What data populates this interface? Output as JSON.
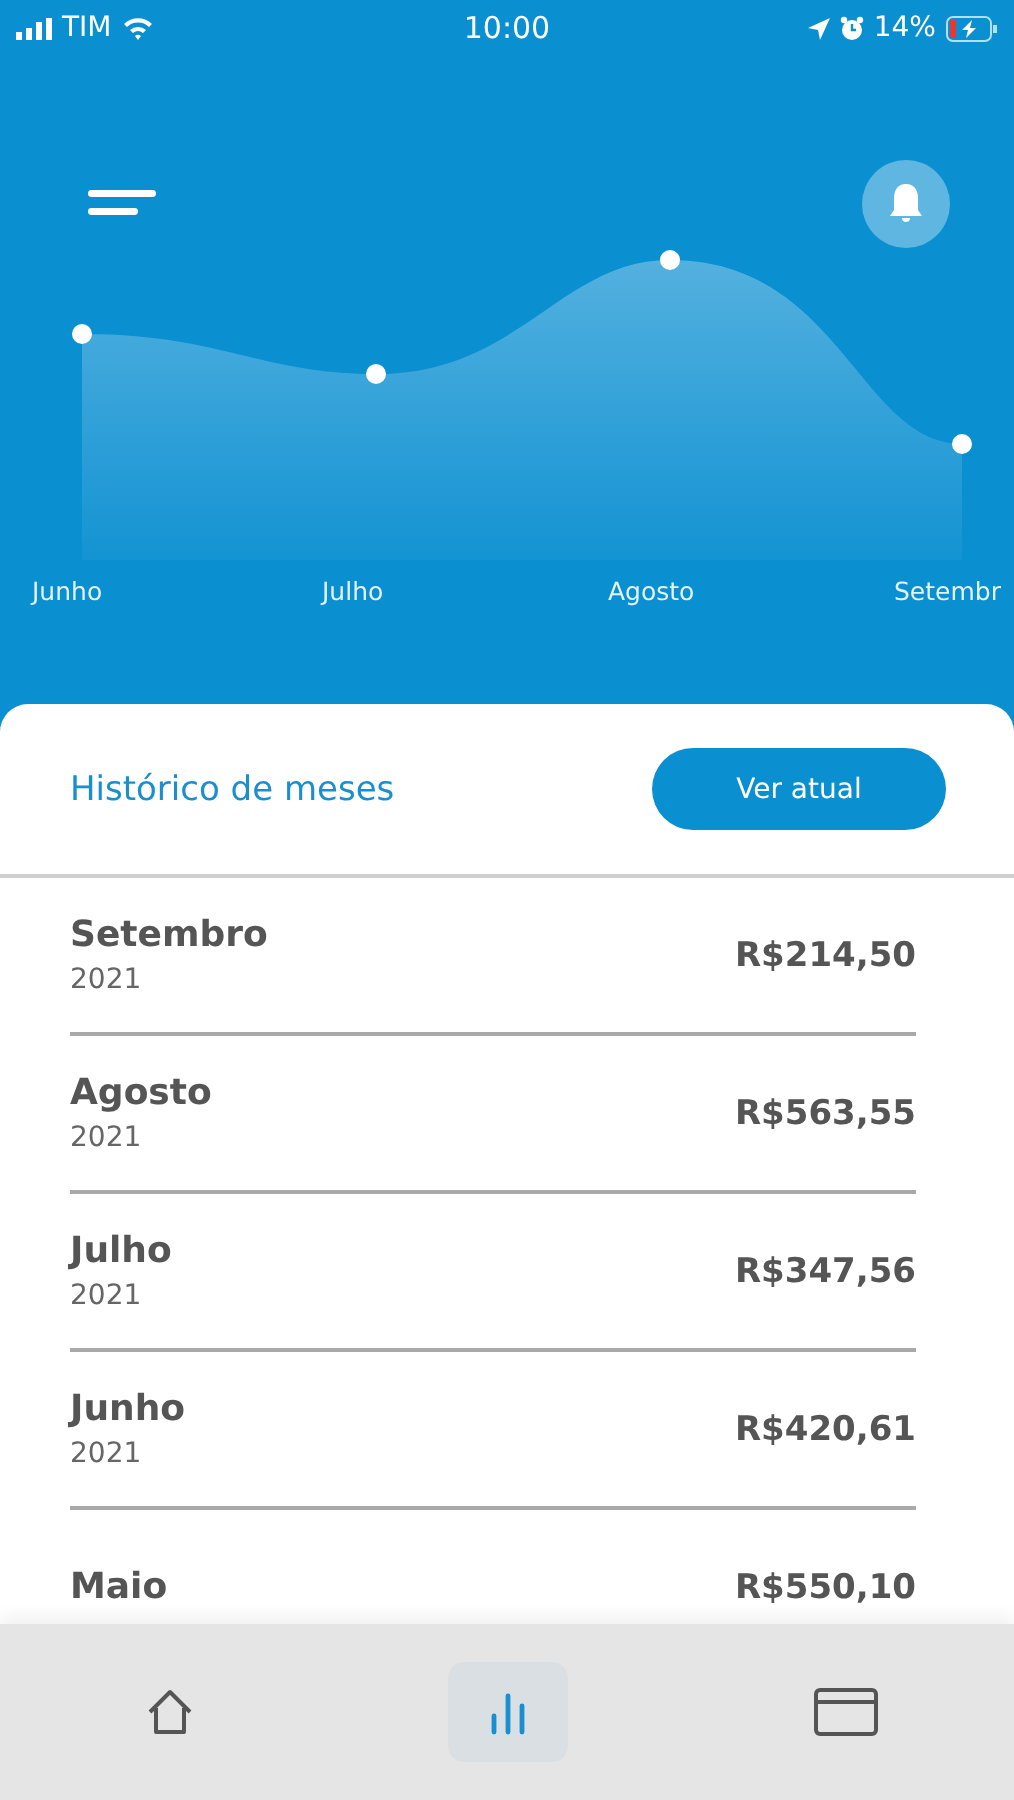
{
  "status_bar": {
    "carrier": "TIM",
    "time": "10:00",
    "battery": "14%"
  },
  "chart": {
    "months": [
      "Junho",
      "Julho",
      "Agosto",
      "Setembr"
    ]
  },
  "history": {
    "title": "Histórico de meses",
    "button": "Ver atual",
    "rows": [
      {
        "month": "Setembro",
        "year": "2021",
        "amount": "R$214,50"
      },
      {
        "month": "Agosto",
        "year": "2021",
        "amount": "R$563,55"
      },
      {
        "month": "Julho",
        "year": "2021",
        "amount": "R$347,56"
      },
      {
        "month": "Junho",
        "year": "2021",
        "amount": "R$420,61"
      },
      {
        "month": "Maio",
        "amount": "R$550,10"
      }
    ]
  },
  "bottom_nav": [
    {
      "kind": "home",
      "selected": false
    },
    {
      "kind": "chart",
      "selected": true
    },
    {
      "kind": "card",
      "selected": false
    }
  ]
}
